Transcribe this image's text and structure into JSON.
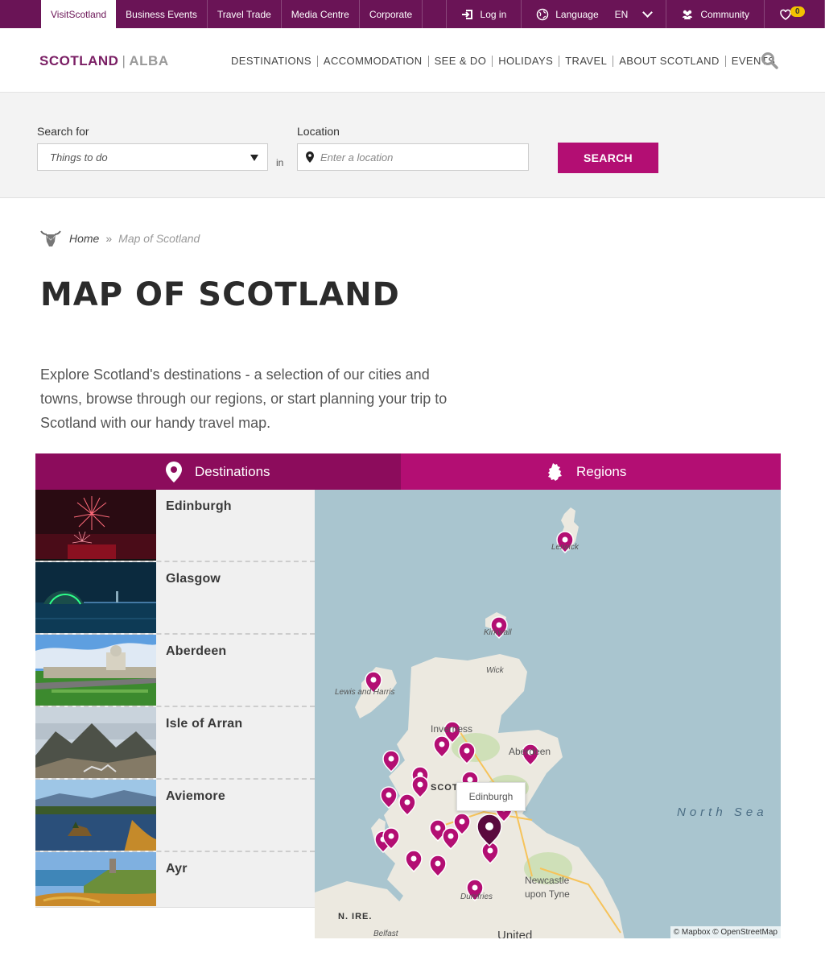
{
  "topbar": {
    "links": [
      "VisitScotland",
      "Business Events",
      "Travel Trade",
      "Media Centre",
      "Corporate"
    ],
    "login": "Log in",
    "language": "Language",
    "language_code": "EN",
    "community": "Community",
    "favourites_count": "0"
  },
  "header": {
    "logo_main": "SCOTLAND",
    "logo_sep": "|",
    "logo_alt": "ALBA",
    "nav": [
      "DESTINATIONS",
      "ACCOMMODATION",
      "SEE & DO",
      "HOLIDAYS",
      "TRAVEL",
      "ABOUT SCOTLAND",
      "EVENTS"
    ]
  },
  "search": {
    "search_for_label": "Search for",
    "search_for_value": "Things to do",
    "in_label": "in",
    "location_label": "Location",
    "location_placeholder": "Enter a location",
    "button": "SEARCH"
  },
  "breadcrumb": {
    "home": "Home",
    "sep": "»",
    "current": "Map of Scotland"
  },
  "page": {
    "title": "MAP OF SCOTLAND",
    "intro": "Explore Scotland's destinations - a selection of our cities and towns, browse through our regions, or start planning your trip to Scotland with our handy travel map."
  },
  "tabs": {
    "destinations": "Destinations",
    "regions": "Regions"
  },
  "destinations": [
    "Edinburgh",
    "Glasgow",
    "Aberdeen",
    "Isle of Arran",
    "Aviemore",
    "Ayr"
  ],
  "map": {
    "labels": {
      "lerwick": "Lerwick",
      "kirkwall": "Kirkwall",
      "wick": "Wick",
      "lewis": "Lewis and Harris",
      "inverness": "Inverness",
      "aberdeen": "Aberdeen",
      "scotland": "SCOT",
      "north_sea": "North Sea",
      "newcastle1": "Newcastle",
      "newcastle2": "upon Tyne",
      "dumfries": "Dumfries",
      "nire": "N. IRE.",
      "belfast": "Belfast",
      "united": "United"
    },
    "tooltip": "Edinburgh",
    "attribution": "© Mapbox © OpenStreetMap"
  }
}
